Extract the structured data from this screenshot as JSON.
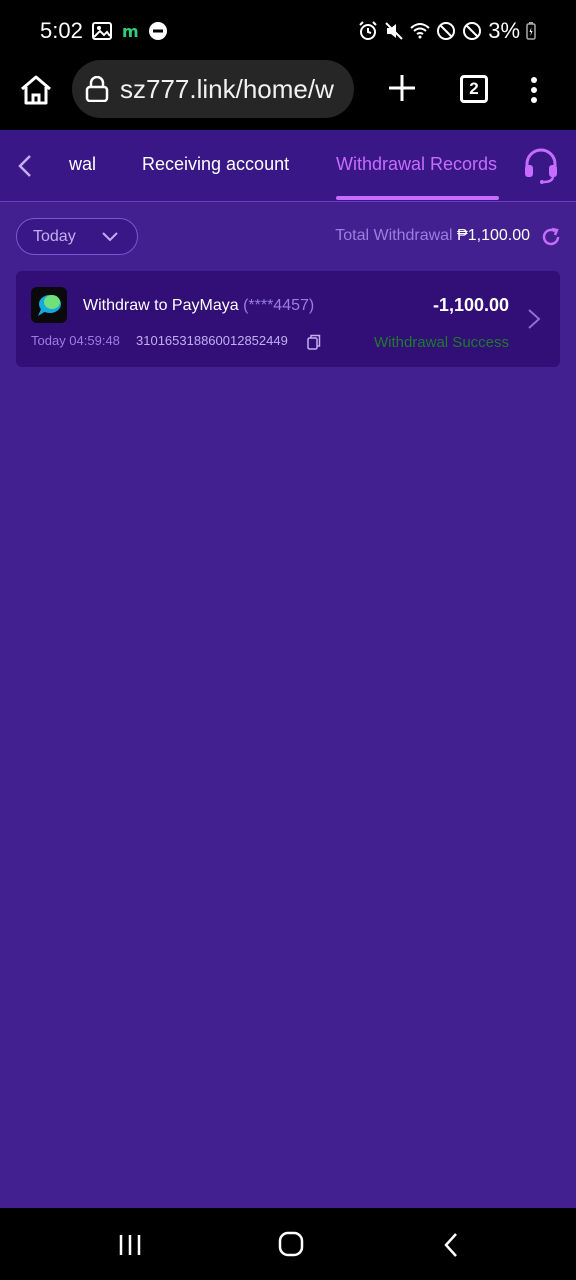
{
  "status_bar": {
    "time": "5:02",
    "battery": "3%",
    "left_icons": [
      "image-icon",
      "m-icon",
      "dnd-icon"
    ],
    "right_icons": [
      "alarm-icon",
      "mute-icon",
      "wifi-icon",
      "blocked-icon",
      "blocked-icon",
      "battery-icon"
    ]
  },
  "browser": {
    "url": "sz777.link/home/w",
    "tab_count": "2"
  },
  "nav": {
    "tabs": [
      {
        "label": "wal"
      },
      {
        "label": "Receiving account"
      },
      {
        "label": "Withdrawal Records"
      }
    ],
    "active_tab": "Withdrawal Records"
  },
  "filter": {
    "selected": "Today"
  },
  "summary": {
    "total_label": "Total Withdrawal",
    "total_amount": "₱1,100.00"
  },
  "records": [
    {
      "title": "Withdraw to PayMaya",
      "account": "(****4457)",
      "amount": "-1,100.00",
      "time": "Today 04:59:48",
      "id": "310165318860012852449",
      "status": "Withdrawal Success"
    }
  ],
  "colors": {
    "background": "#43208f",
    "nav_background": "#3a1786",
    "active_tab": "#c66cff",
    "card": "#320e77",
    "status_success": "#1f7a2e"
  }
}
